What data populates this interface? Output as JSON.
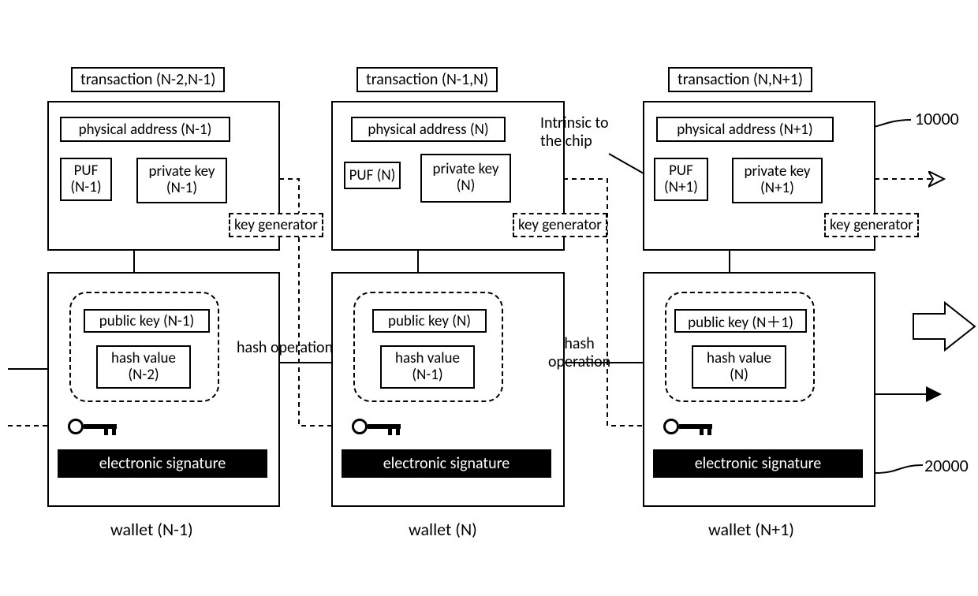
{
  "transactions": [
    {
      "label": "transaction (N-2,N-1)"
    },
    {
      "label": "transaction (N-1,N)"
    },
    {
      "label": "transaction (N,N+1)"
    }
  ],
  "columns": [
    {
      "physical_address": "physical address (N-1)",
      "puf": "PUF\n(N-1)",
      "private_key": "private key\n(N-1)",
      "public_key": "public key (N-1)",
      "hash_value": "hash value\n(N-2)",
      "esig": "electronic signature",
      "keygen": "key generator",
      "wallet": "wallet (N-1)"
    },
    {
      "physical_address": "physical address (N)",
      "puf": "PUF (N)",
      "private_key": "private key\n(N)",
      "public_key": "public key (N)",
      "hash_value": "hash value\n(N-1)",
      "esig": "electronic signature",
      "keygen": "key generator",
      "wallet": "wallet (N)"
    },
    {
      "physical_address": "physical address (N+1)",
      "puf": "PUF\n(N+1)",
      "private_key": "private key\n(N+1)",
      "public_key": "public key (N＋1)",
      "hash_value": "hash value\n(N)",
      "esig": "electronic signature",
      "keygen": "key generator",
      "wallet": "wallet (N+1)"
    }
  ],
  "arrows_text": {
    "hash_op_1": "hash operation",
    "hash_op_2": "hash\noperation",
    "intrinsic": "Intrinsic to\nthe chip"
  },
  "callouts": {
    "top": "10000",
    "bottom": "20000"
  }
}
